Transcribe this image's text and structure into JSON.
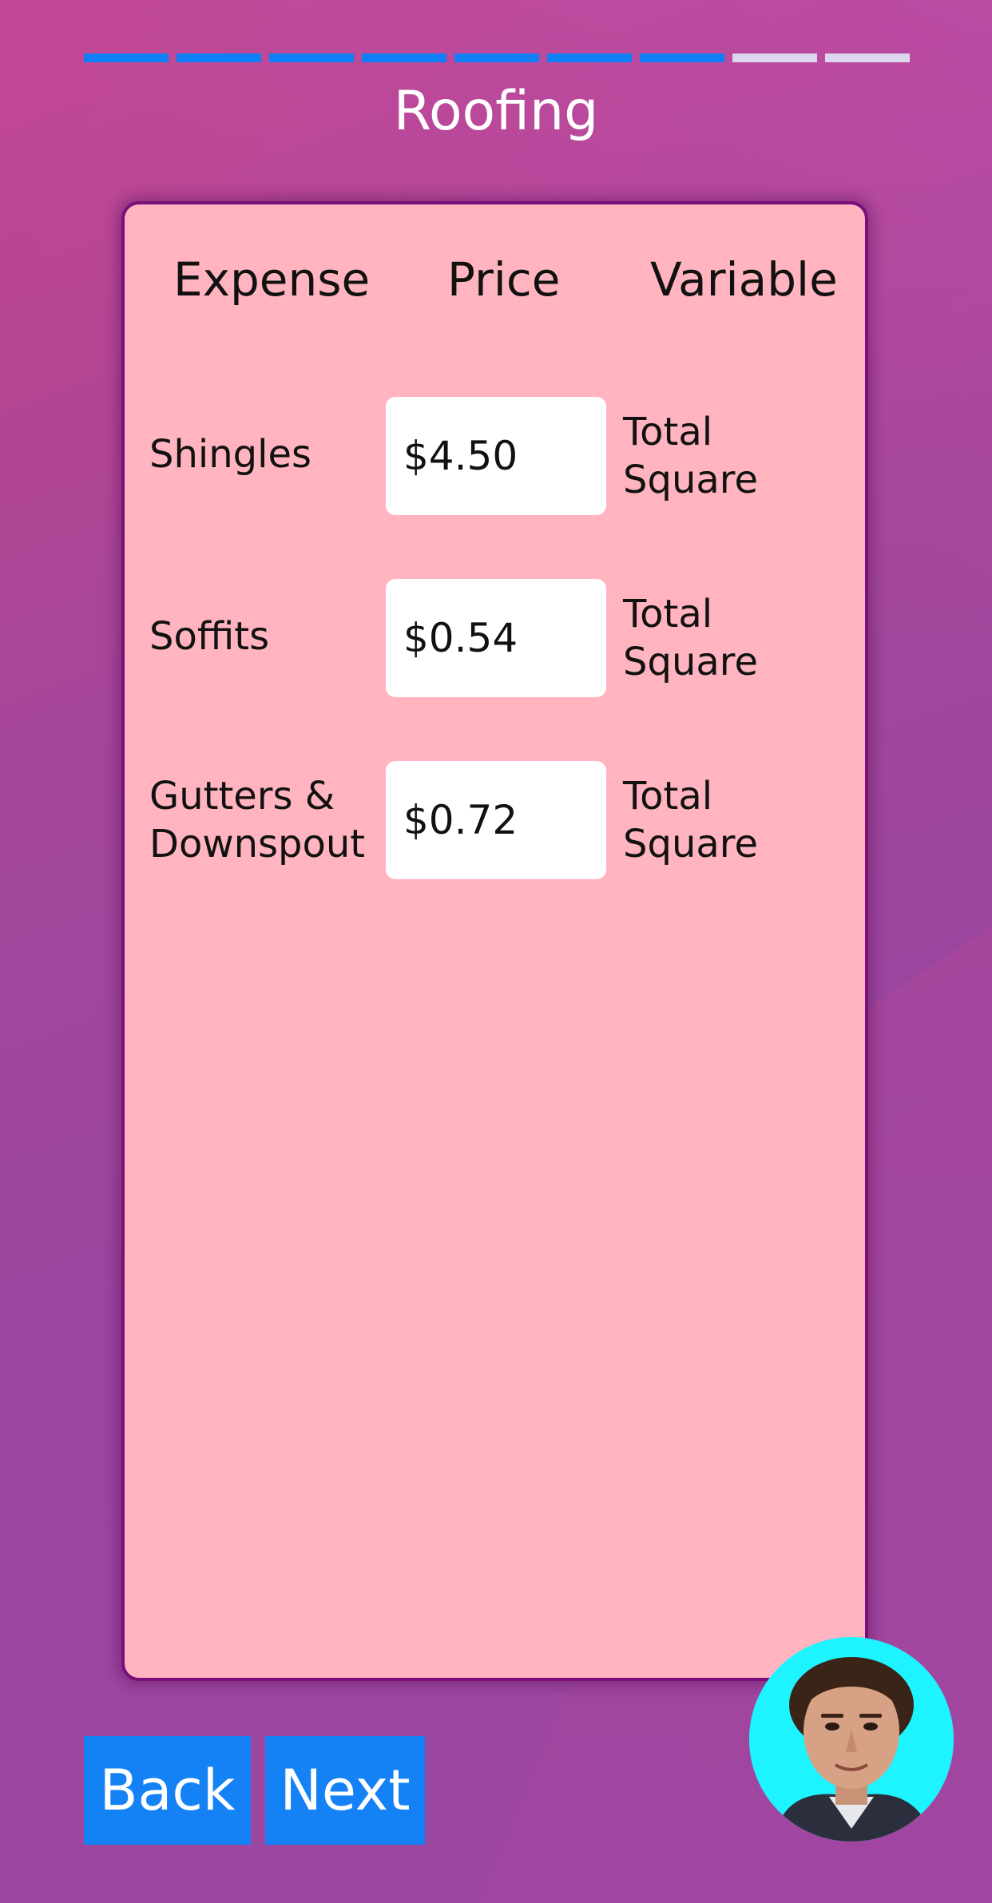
{
  "header": {
    "title": "Roofing",
    "progress_segments": [
      true,
      true,
      true,
      true,
      true,
      true,
      true,
      false,
      false
    ]
  },
  "colors": {
    "progress_active": "#0f7ff5",
    "progress_inactive": "#dcd7ee",
    "card_background": "#ffb4c0",
    "card_border": "#7a0e7a",
    "button_background": "#1482f5",
    "avatar_ring": "#1ef4ff"
  },
  "table": {
    "headers": {
      "expense": "Expense",
      "price": "Price",
      "variable": "Variable"
    },
    "rows": [
      {
        "expense": "Shingles",
        "price": "$4.50",
        "variable": "Total Square"
      },
      {
        "expense": "Soffits",
        "price": "$0.54",
        "variable": "Total Square"
      },
      {
        "expense": "Gutters & Downspout",
        "price": "$0.72",
        "variable": "Total Square"
      }
    ]
  },
  "footer": {
    "back_label": "Back",
    "next_label": "Next",
    "avatar_icon": "user-avatar-photo"
  }
}
